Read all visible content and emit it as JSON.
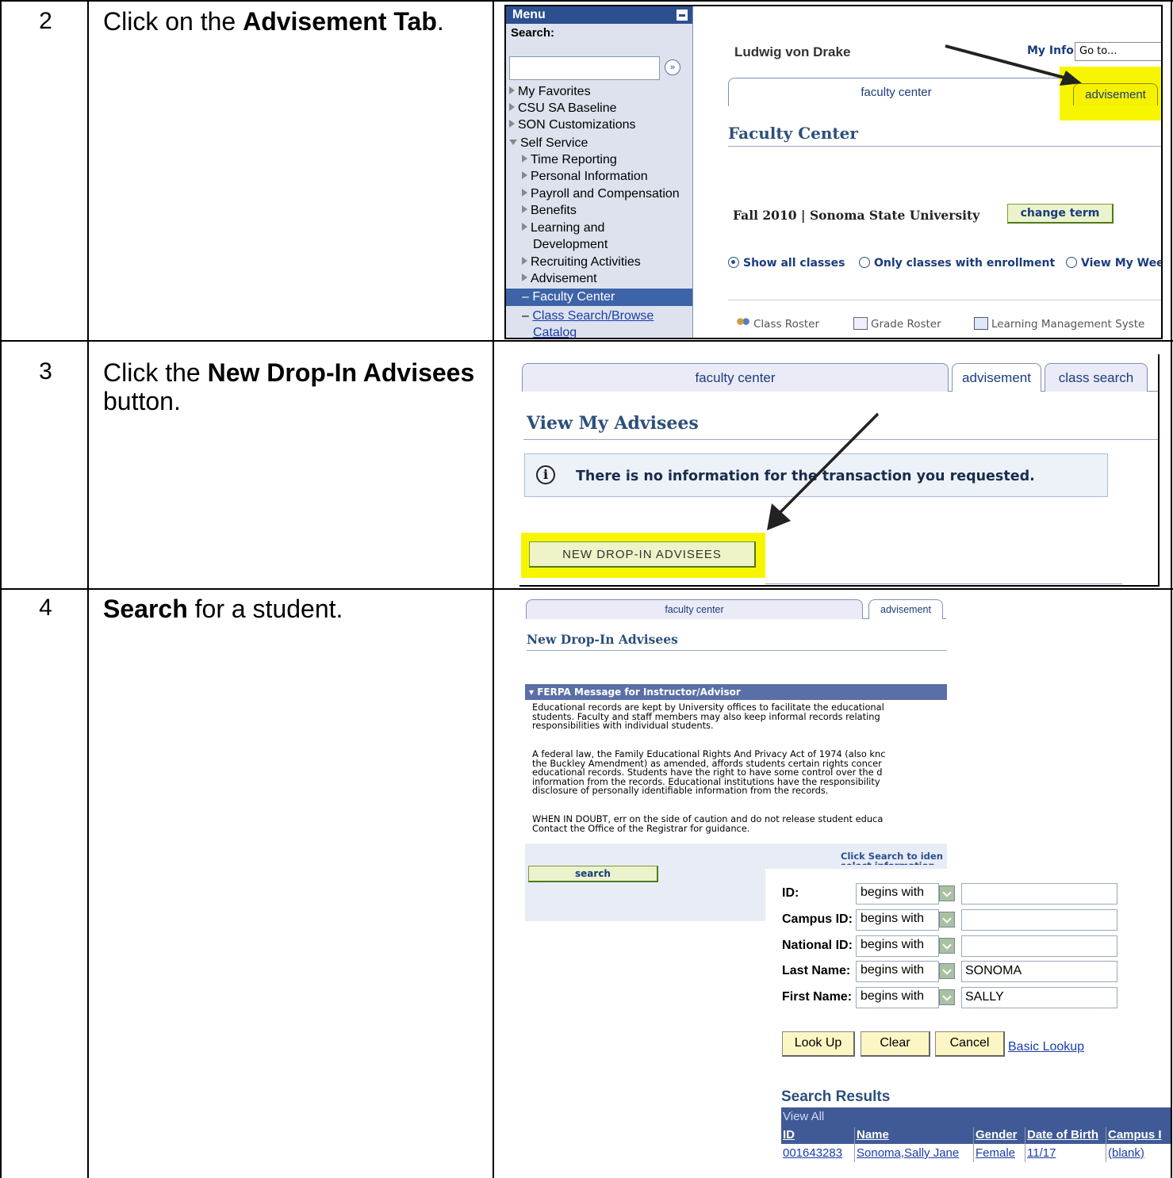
{
  "steps": [
    {
      "number": "2",
      "instruction_pre": "Click on the ",
      "instruction_bold": "Advisement Tab",
      "instruction_post": "."
    },
    {
      "number": "3",
      "instruction_pre": "Click the ",
      "instruction_bold": "New Drop-In Advisees",
      "instruction_post": " button."
    },
    {
      "number": "4",
      "instruction_pre": "",
      "instruction_bold": "Search",
      "instruction_post": " for a student."
    }
  ],
  "panel1": {
    "menu": {
      "title": "Menu",
      "search_label": "Search:",
      "items": [
        "My Favorites",
        "CSU SA Baseline",
        "SON Customizations",
        "Self Service",
        "Time Reporting",
        "Personal Information",
        "Payroll and Compensation",
        "Benefits",
        "Learning and",
        "Development",
        "Recruiting Activities",
        "Advisement",
        "Faculty Center",
        "Class Search/Browse",
        "Catalog"
      ]
    },
    "user_name": "Ludwig von Drake",
    "my_info": "My Info",
    "goto": "Go to...",
    "tab_faculty": "faculty center",
    "tab_advisement": "advisement",
    "page_title": "Faculty Center",
    "term": "Fall 2010 | Sonoma State University",
    "change_term": "change term",
    "radio_all": "Show all classes",
    "radio_enroll": "Only classes with enrollment",
    "radio_week": "View My Wee",
    "tool_roster": "Class Roster",
    "tool_grade": "Grade Roster",
    "tool_lms": "Learning Management Syste"
  },
  "panel2": {
    "tab_faculty": "faculty center",
    "tab_advisement": "advisement",
    "tab_class_search": "class search",
    "page_title": "View My Advisees",
    "info_message": "There is no information for the transaction you requested.",
    "button": "New Drop-In Advisees"
  },
  "panel3": {
    "tab_faculty": "faculty center",
    "tab_advisement": "advisement",
    "page_title": "New Drop-In Advisees",
    "ferpa_header": "FERPA Message for Instructor/Advisor",
    "ferpa_p1": "Educational records are kept by University offices to facilitate the educational\nstudents. Faculty and staff members may also keep informal records relating\nresponsibilities with individual students.",
    "ferpa_p2": "A federal law, the Family Educational Rights And Privacy Act of 1974 (also knc\nthe Buckley Amendment) as amended, affords students certain rights concer\neducational records. Students have the right to have some control over the d\ninformation from the records. Educational institutions have the responsibility\ndisclosure of personally identifiable information from the records.",
    "ferpa_p3": "WHEN IN DOUBT, err on the side of caution and do not release student educa\nContact the Office of the Registrar for guidance.",
    "click_search": "Click Search to iden",
    "click_search2": "select information",
    "search_button": "search",
    "fields": [
      {
        "label": "ID:",
        "op": "begins with",
        "value": ""
      },
      {
        "label": "Campus ID:",
        "op": "begins with",
        "value": ""
      },
      {
        "label": "National ID:",
        "op": "begins with",
        "value": ""
      },
      {
        "label": "Last Name:",
        "op": "begins with",
        "value": "SONOMA"
      },
      {
        "label": "First Name:",
        "op": "begins with",
        "value": "SALLY"
      }
    ],
    "btn_lookup": "Look Up",
    "btn_clear": "Clear",
    "btn_cancel": "Cancel",
    "link_basic": "Basic Lookup",
    "results_title": "Search Results",
    "view_all": "View All",
    "columns": [
      "ID",
      "Name",
      "Gender",
      "Date of Birth",
      "Campus I"
    ],
    "row": [
      "001643283",
      "Sonoma,Sally Jane",
      "Female",
      "11/17",
      "(blank)"
    ]
  }
}
